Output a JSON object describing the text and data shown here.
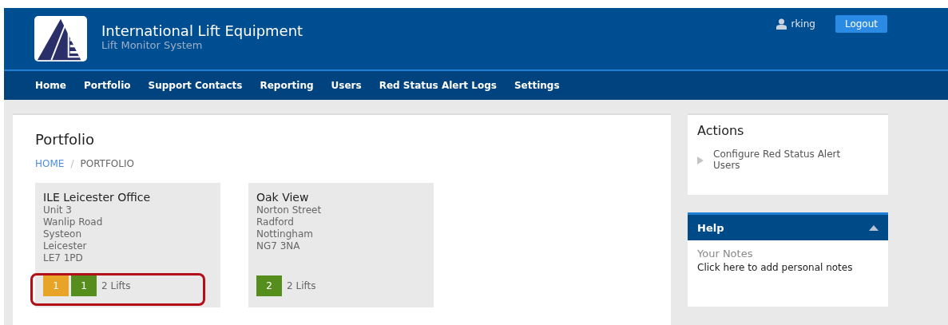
{
  "header": {
    "company": "International Lift Equipment",
    "subtitle": "Lift Monitor System",
    "user": "rking",
    "logout": "Logout"
  },
  "nav": [
    {
      "label": "Home"
    },
    {
      "label": "Portfolio"
    },
    {
      "label": "Support Contacts"
    },
    {
      "label": "Reporting"
    },
    {
      "label": "Users"
    },
    {
      "label": "Red Status Alert Logs"
    },
    {
      "label": "Settings"
    }
  ],
  "page": {
    "title": "Portfolio",
    "breadcrumb_separator": "/",
    "breadcrumb": [
      {
        "label": "HOME",
        "link": true
      },
      {
        "label": "PORTFOLIO",
        "link": false
      }
    ]
  },
  "locations": [
    {
      "name": "ILE Leicester Office",
      "address": [
        "Unit 3",
        "Wanlip Road",
        "Systeon",
        "Leicester",
        "LE7 1PD"
      ],
      "highlighted": true,
      "statuses": [
        {
          "count": "1",
          "color": "#e8a427"
        },
        {
          "count": "1",
          "color": "#568e1e"
        }
      ],
      "lifts": "2 Lifts"
    },
    {
      "name": "Oak View",
      "address": [
        "Norton Street",
        "Radford",
        "Nottingham",
        "NG7 3NA"
      ],
      "highlighted": false,
      "statuses": [
        {
          "count": "2",
          "color": "#568e1e"
        }
      ],
      "lifts": "2 Lifts"
    }
  ],
  "actions": {
    "title": "Actions",
    "items": [
      "Configure Red Status Alert Users"
    ]
  },
  "help": {
    "title": "Help",
    "expanded": true,
    "notes_label": "Your Notes",
    "notes_link": "Click here to add personal notes"
  }
}
